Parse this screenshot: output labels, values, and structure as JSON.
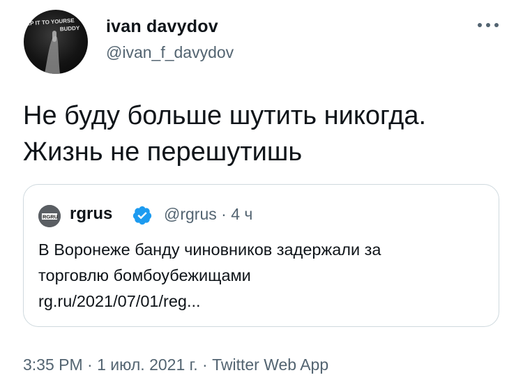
{
  "author": {
    "display_name": "ivan davydov",
    "handle": "@ivan_f_davydov",
    "avatar_text_line1": "EP IT TO YOURSE",
    "avatar_text_line2": "BUDDY"
  },
  "more_icon": "more-horizontal-icon",
  "tweet": {
    "lines": [
      "Не буду больше шутить никогда.",
      "Жизнь не перешутишь"
    ]
  },
  "quoted": {
    "avatar_logo": "RGRU",
    "name": "rgrus",
    "verified_icon": "verified-badge-icon",
    "verified_color": "#1d9bf0",
    "handle": "@rgrus",
    "separator": "·",
    "time": "4 ч",
    "lines": [
      "В Воронеже банду чиновников задержали за",
      "торговлю бомбоубежищами",
      "rg.ru/2021/07/01/reg..."
    ]
  },
  "footer": {
    "time": "3:35 PM",
    "separator1": "·",
    "date": "1 июл. 2021 г.",
    "separator2": "·",
    "source": "Twitter Web App"
  }
}
